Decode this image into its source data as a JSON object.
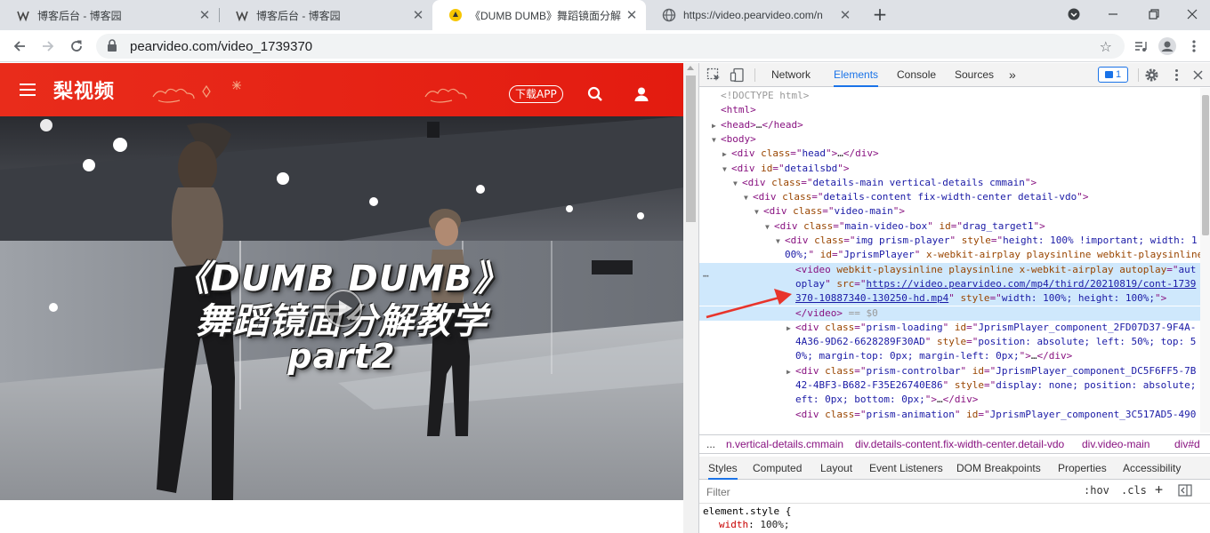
{
  "browser": {
    "tabs": [
      {
        "title": "博客后台 - 博客园",
        "active": false
      },
      {
        "title": "博客后台 - 博客园",
        "active": false
      },
      {
        "title": "《DUMB DUMB》舞蹈镜面分解",
        "active": true
      },
      {
        "title": "https://video.pearvideo.com/n",
        "active": false
      }
    ],
    "new_tab": "+",
    "url": "pearvideo.com/video_1739370"
  },
  "site": {
    "logo": "梨视频",
    "download_app": "下载APP",
    "video_title_line1": "《DUMB DUMB》",
    "video_title_line2": "舞蹈镜面分解教学",
    "video_title_line3": "part2"
  },
  "devtools": {
    "tabs": [
      "Network",
      "Elements",
      "Console",
      "Sources"
    ],
    "active_tab": "Elements",
    "more": "»",
    "issues_count": "1",
    "dom_lines": [
      {
        "indent": 0,
        "tri": "",
        "html": [
          [
            "dim",
            "<!DOCTYPE html>"
          ]
        ]
      },
      {
        "indent": 0,
        "tri": "",
        "html": [
          [
            "tag",
            "<html>"
          ]
        ]
      },
      {
        "indent": 0,
        "tri": "▶",
        "html": [
          [
            "tag",
            "<head>"
          ],
          [
            "",
            "…"
          ],
          [
            "tag",
            "</head>"
          ]
        ]
      },
      {
        "indent": 0,
        "tri": "▼",
        "html": [
          [
            "tag",
            "<body>"
          ]
        ]
      },
      {
        "indent": 1,
        "tri": "▶",
        "html": [
          [
            "tag",
            "<div "
          ],
          [
            "attr",
            "class"
          ],
          [
            "tag",
            "=\""
          ],
          [
            "val",
            "head"
          ],
          [
            "tag",
            "\">"
          ],
          [
            "",
            "…"
          ],
          [
            "tag",
            "</div>"
          ]
        ]
      },
      {
        "indent": 1,
        "tri": "▼",
        "html": [
          [
            "tag",
            "<div "
          ],
          [
            "attr",
            "id"
          ],
          [
            "tag",
            "=\""
          ],
          [
            "val",
            "detailsbd"
          ],
          [
            "tag",
            "\">"
          ]
        ]
      },
      {
        "indent": 2,
        "tri": "▼",
        "html": [
          [
            "tag",
            "<div "
          ],
          [
            "attr",
            "class"
          ],
          [
            "tag",
            "=\""
          ],
          [
            "val",
            "details-main vertical-details cmmain"
          ],
          [
            "tag",
            "\">"
          ]
        ]
      },
      {
        "indent": 3,
        "tri": "▼",
        "html": [
          [
            "tag",
            "<div "
          ],
          [
            "attr",
            "class"
          ],
          [
            "tag",
            "=\""
          ],
          [
            "val",
            "details-content fix-width-center detail-vdo"
          ],
          [
            "tag",
            "\">"
          ]
        ]
      },
      {
        "indent": 4,
        "tri": "▼",
        "html": [
          [
            "tag",
            "<div "
          ],
          [
            "attr",
            "class"
          ],
          [
            "tag",
            "=\""
          ],
          [
            "val",
            "video-main"
          ],
          [
            "tag",
            "\">"
          ]
        ]
      },
      {
        "indent": 5,
        "tri": "▼",
        "html": [
          [
            "tag",
            "<div "
          ],
          [
            "attr",
            "class"
          ],
          [
            "tag",
            "=\""
          ],
          [
            "val",
            "main-video-box"
          ],
          [
            "tag",
            "\" "
          ],
          [
            "attr",
            "id"
          ],
          [
            "tag",
            "=\""
          ],
          [
            "val",
            "drag_target1"
          ],
          [
            "tag",
            "\">"
          ]
        ]
      },
      {
        "indent": 6,
        "tri": "▼",
        "html": [
          [
            "tag",
            "<div "
          ],
          [
            "attr",
            "class"
          ],
          [
            "tag",
            "=\""
          ],
          [
            "val",
            "img prism-player"
          ],
          [
            "tag",
            "\" "
          ],
          [
            "attr",
            "style"
          ],
          [
            "tag",
            "=\""
          ],
          [
            "val",
            "height: 100% !important; width: 1"
          ]
        ]
      },
      {
        "indent": 6,
        "tri": "",
        "cont": true,
        "html": [
          [
            "val",
            "00%;"
          ],
          [
            "tag",
            "\" "
          ],
          [
            "attr",
            "id"
          ],
          [
            "tag",
            "=\""
          ],
          [
            "val",
            "JprismPlayer"
          ],
          [
            "tag",
            "\" "
          ],
          [
            "attr",
            "x-webkit-airplay playsinline webkit-playsinline"
          ],
          [
            "tag",
            ">"
          ]
        ]
      },
      {
        "indent": 7,
        "tri": "",
        "sel": true,
        "html": [
          [
            "tag",
            "<video "
          ],
          [
            "attr",
            "webkit-playsinline playsinline x-webkit-airplay autoplay"
          ],
          [
            "tag",
            "=\""
          ],
          [
            "val",
            "aut"
          ]
        ]
      },
      {
        "indent": 7,
        "tri": "",
        "sel": true,
        "cont": true,
        "html": [
          [
            "val",
            "oplay"
          ],
          [
            "tag",
            "\" "
          ],
          [
            "attr",
            "src"
          ],
          [
            "tag",
            "=\""
          ],
          [
            "lnk",
            "https://video.pearvideo.com/mp4/third/20210819/cont-1739"
          ]
        ]
      },
      {
        "indent": 7,
        "tri": "",
        "sel": true,
        "cont": true,
        "html": [
          [
            "lnk",
            "370-10887340-130250-hd.mp4"
          ],
          [
            "tag",
            "\" "
          ],
          [
            "attr",
            "style"
          ],
          [
            "tag",
            "=\""
          ],
          [
            "val",
            "width: 100%; height: 100%;"
          ],
          [
            "tag",
            "\">"
          ]
        ]
      },
      {
        "indent": 7,
        "tri": "",
        "sel": true,
        "html": [
          [
            "tag",
            "</video>"
          ],
          [
            "dim",
            " == $0"
          ]
        ]
      },
      {
        "indent": 7,
        "tri": "▶",
        "html": [
          [
            "tag",
            "<div "
          ],
          [
            "attr",
            "class"
          ],
          [
            "tag",
            "=\""
          ],
          [
            "val",
            "prism-loading"
          ],
          [
            "tag",
            "\" "
          ],
          [
            "attr",
            "id"
          ],
          [
            "tag",
            "=\""
          ],
          [
            "val",
            "JprismPlayer_component_2FD07D37-9F4A-"
          ]
        ]
      },
      {
        "indent": 7,
        "tri": "",
        "cont": true,
        "html": [
          [
            "val",
            "4A36-9D62-6628289F30AD"
          ],
          [
            "tag",
            "\" "
          ],
          [
            "attr",
            "style"
          ],
          [
            "tag",
            "=\""
          ],
          [
            "val",
            "position: absolute; left: 50%; top: 5"
          ]
        ]
      },
      {
        "indent": 7,
        "tri": "",
        "cont": true,
        "html": [
          [
            "val",
            "0%; margin-top: 0px; margin-left: 0px;"
          ],
          [
            "tag",
            "\">"
          ],
          [
            "",
            "…"
          ],
          [
            "tag",
            "</div>"
          ]
        ]
      },
      {
        "indent": 7,
        "tri": "▶",
        "html": [
          [
            "tag",
            "<div "
          ],
          [
            "attr",
            "class"
          ],
          [
            "tag",
            "=\""
          ],
          [
            "val",
            "prism-controlbar"
          ],
          [
            "tag",
            "\" "
          ],
          [
            "attr",
            "id"
          ],
          [
            "tag",
            "=\""
          ],
          [
            "val",
            "JprismPlayer_component_DC5F6FF5-7B"
          ]
        ]
      },
      {
        "indent": 7,
        "tri": "",
        "cont": true,
        "html": [
          [
            "val",
            "42-4BF3-B682-F35E26740E86"
          ],
          [
            "tag",
            "\" "
          ],
          [
            "attr",
            "style"
          ],
          [
            "tag",
            "=\""
          ],
          [
            "val",
            "display: none; position: absolute; l"
          ]
        ]
      },
      {
        "indent": 7,
        "tri": "",
        "cont": true,
        "html": [
          [
            "val",
            "eft: 0px; bottom: 0px;"
          ],
          [
            "tag",
            "\">"
          ],
          [
            "",
            "…"
          ],
          [
            "tag",
            "</div>"
          ]
        ]
      },
      {
        "indent": 7,
        "tri": "",
        "html": [
          [
            "tag",
            "<div "
          ],
          [
            "attr",
            "class"
          ],
          [
            "tag",
            "=\""
          ],
          [
            "val",
            "prism-animation"
          ],
          [
            "tag",
            "\" "
          ],
          [
            "attr",
            "id"
          ],
          [
            "tag",
            "=\""
          ],
          [
            "val",
            "JprismPlayer_component_3C517AD5-490"
          ]
        ]
      }
    ],
    "breadcrumbs": [
      "...",
      "n.vertical-details.cmmain",
      "div.details-content.fix-width-center.detail-vdo",
      "div.video-main",
      "div#d"
    ],
    "style_tabs": [
      "Styles",
      "Computed",
      "Layout",
      "Event Listeners",
      "DOM Breakpoints",
      "Properties",
      "Accessibility"
    ],
    "filter_placeholder": "Filter",
    "hov": ":hov",
    "cls": ".cls",
    "plus": "+",
    "styles_line1": "element.style {",
    "styles_prop": "width",
    "styles_value": "100%;"
  },
  "colors": {
    "site_red": "#e31b10",
    "devtools_blue": "#1a73e8",
    "selected_row": "#cfe8fc",
    "arrow_red": "#e8342b"
  }
}
